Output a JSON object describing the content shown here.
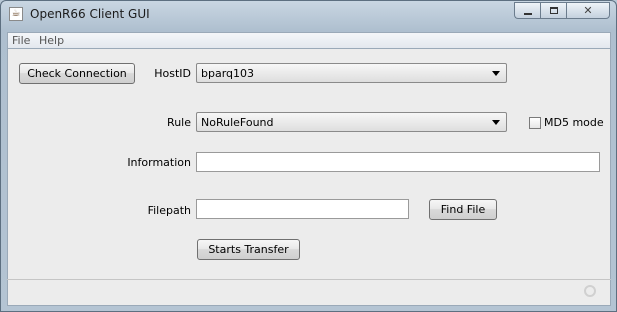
{
  "window": {
    "title": "OpenR66 Client GUI",
    "icon": "java-cup-icon"
  },
  "menu": {
    "items": [
      {
        "label": "File"
      },
      {
        "label": "Help"
      }
    ]
  },
  "form": {
    "check_connection_label": "Check Connection",
    "hostid_label": "HostID",
    "hostid_value": "bparq103",
    "rule_label": "Rule",
    "rule_value": "NoRuleFound",
    "md5_label": "MD5 mode",
    "md5_checked": false,
    "information_label": "Information",
    "information_value": "",
    "filepath_label": "Filepath",
    "filepath_value": "",
    "find_file_label": "Find File",
    "transfer_label": "Starts Transfer"
  }
}
